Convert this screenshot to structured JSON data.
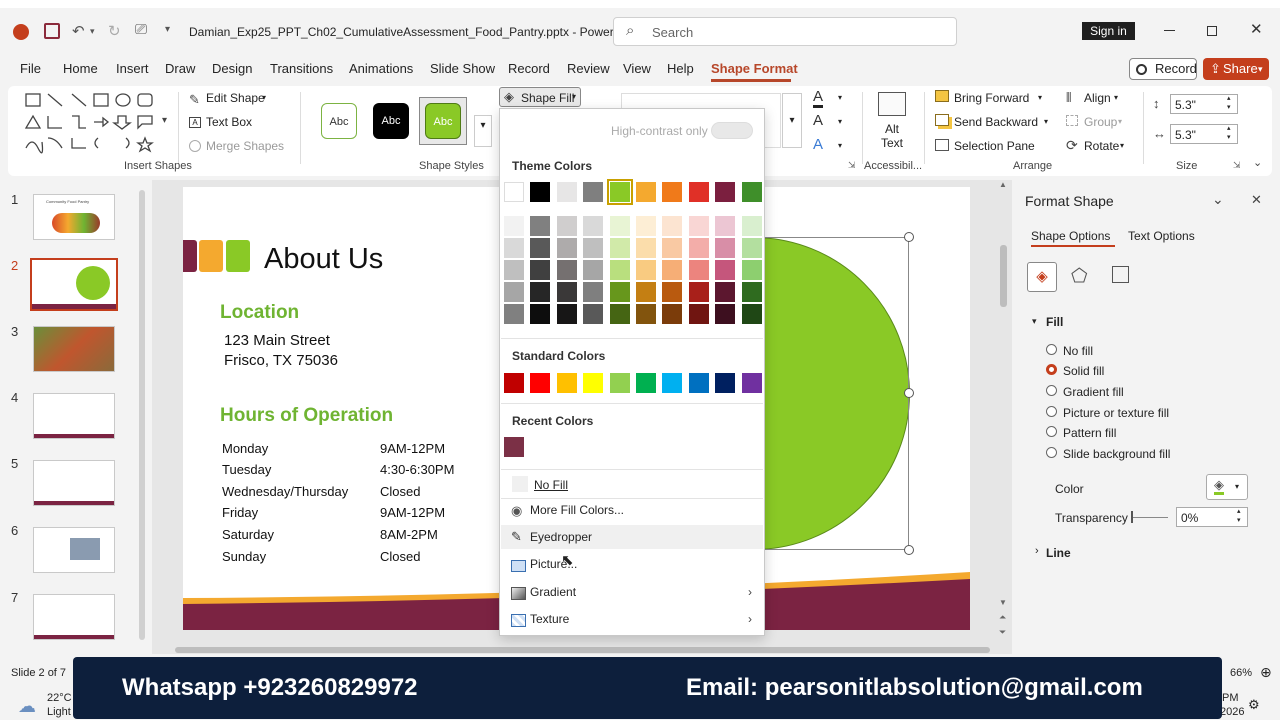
{
  "title": {
    "filename": "Damian_Exp25_PPT_Ch02_CumulativeAssessment_Food_Pantry.pptx",
    "sep": "-",
    "app": "PowerP...",
    "search_placeholder": "Search",
    "signin": "Sign in"
  },
  "menus": [
    "File",
    "Home",
    "Insert",
    "Draw",
    "Design",
    "Transitions",
    "Animations",
    "Slide Show",
    "Record",
    "Review",
    "View",
    "Help",
    "Shape Format"
  ],
  "record_label": "Record",
  "share_label": "Share",
  "ribbon": {
    "edit_shape": "Edit Shape",
    "text_box": "Text Box",
    "merge_shapes": "Merge Shapes",
    "insert_shapes_label": "Insert Shapes",
    "style_label": "Abc",
    "shape_styles_label": "Shape Styles",
    "shape_fill": "Shape Fill",
    "alt_text": "Alt Text",
    "accessibility_label": "Accessibil...",
    "bring_forward": "Bring Forward",
    "send_backward": "Send Backward",
    "selection_pane": "Selection Pane",
    "align": "Align",
    "group": "Group",
    "rotate": "Rotate",
    "arrange_label": "Arrange",
    "height": "5.3\"",
    "width": "5.3\"",
    "size_label": "Size"
  },
  "dropdown": {
    "high_contrast": "High-contrast only",
    "theme_colors": "Theme Colors",
    "standard_colors": "Standard Colors",
    "recent_colors": "Recent Colors",
    "no_fill": "No Fill",
    "more_fill_colors": "More Fill Colors...",
    "eyedropper": "Eyedropper",
    "picture": "Picture...",
    "gradient": "Gradient",
    "texture": "Texture",
    "theme_top": [
      "#ffffff",
      "#000000",
      "#e7e6e6",
      "#7f7f7f",
      "#8ac926",
      "#f4a92f",
      "#f07a1a",
      "#e03027",
      "#7b1f3f",
      "#3f8f2a"
    ],
    "theme_shades": [
      [
        "#f2f2f2",
        "#808080",
        "#d0cece",
        "#d9d9d9",
        "#e8f4d4",
        "#fdeed5",
        "#fce4d1",
        "#f9d6d4",
        "#ecc6d3",
        "#d9efcf"
      ],
      [
        "#d9d9d9",
        "#595959",
        "#aeabab",
        "#bfbfbf",
        "#d1eaa9",
        "#fbddab",
        "#f9c9a3",
        "#f3ada9",
        "#d88ea7",
        "#b3df9f"
      ],
      [
        "#bfbfbf",
        "#404040",
        "#757070",
        "#a6a6a6",
        "#b9df7e",
        "#f9cb81",
        "#f6ae76",
        "#ec847e",
        "#c5567c",
        "#8dcf6f"
      ],
      [
        "#a6a6a6",
        "#262626",
        "#3a3838",
        "#7f7f7f",
        "#67971c",
        "#c47f13",
        "#b95a0f",
        "#a8201a",
        "#5c172f",
        "#2f6b1f"
      ],
      [
        "#808080",
        "#0d0d0d",
        "#171616",
        "#595959",
        "#456513",
        "#82540d",
        "#7b3c0a",
        "#701511",
        "#3d0f1f",
        "#1f4715"
      ]
    ],
    "standard": [
      "#c00000",
      "#ff0000",
      "#ffc000",
      "#ffff00",
      "#92d050",
      "#00b050",
      "#00b0f0",
      "#0070c0",
      "#002060",
      "#7030a0"
    ],
    "recent": [
      "#7b3046"
    ]
  },
  "slides": {
    "count_text": "Slide 2 of 7",
    "nums": [
      "1",
      "2",
      "3",
      "4",
      "5",
      "6",
      "7"
    ],
    "thumb1_title": "Community Food Pantry"
  },
  "slide": {
    "title": "About Us",
    "location_head": "Location",
    "address1": "123 Main Street",
    "address2": "Frisco, TX 75036",
    "hours_head": "Hours of Operation",
    "days": [
      "Monday",
      "Tuesday",
      "Wednesday/Thursday",
      "Friday",
      "Saturday",
      "Sunday"
    ],
    "hours": [
      "9AM-12PM",
      "4:30-6:30PM",
      "Closed",
      "9AM-12PM",
      "8AM-2PM",
      "Closed"
    ],
    "accent_maroon": "#7b2342",
    "accent_orange": "#f4a92f",
    "accent_green": "#8ac926"
  },
  "format_pane": {
    "title": "Format Shape",
    "tab_shape": "Shape Options",
    "tab_text": "Text Options",
    "fill_head": "Fill",
    "options": [
      "No fill",
      "Solid fill",
      "Gradient fill",
      "Picture or texture fill",
      "Pattern fill",
      "Slide background fill"
    ],
    "selected": 1,
    "color_label": "Color",
    "transparency_label": "Transparency",
    "transparency_value": "0%",
    "line_head": "Line"
  },
  "status": {
    "zoom": "66%",
    "weather_temp": "22°C",
    "weather_text": "Light",
    "time": "PM",
    "year": "2026"
  },
  "banner": {
    "whatsapp": "Whatsapp +923260829972",
    "email": "Email: pearsonitlabsolution@gmail.com"
  }
}
